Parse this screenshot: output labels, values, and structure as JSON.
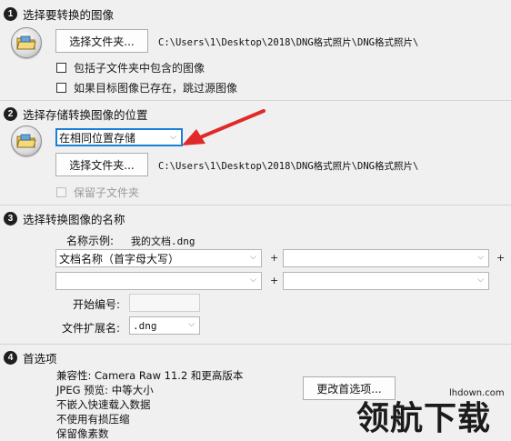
{
  "section1": {
    "number": "1",
    "title": "选择要转换的图像",
    "select_folder_label": "选择文件夹...",
    "path": "C:\\Users\\1\\Desktop\\2018\\DNG格式照片\\DNG格式照片\\",
    "include_subfolders_label": "包括子文件夹中包含的图像",
    "include_subfolders_checked": false,
    "skip_existing_label": "如果目标图像已存在，跳过源图像",
    "skip_existing_checked": false
  },
  "section2": {
    "number": "2",
    "title": "选择存储转换图像的位置",
    "location_select_value": "在相同位置存储",
    "select_folder_label": "选择文件夹...",
    "path": "C:\\Users\\1\\Desktop\\2018\\DNG格式照片\\DNG格式照片\\",
    "preserve_subfolders_label": "保留子文件夹",
    "preserve_subfolders_checked": false,
    "preserve_subfolders_disabled": true
  },
  "section3": {
    "number": "3",
    "title": "选择转换图像的名称",
    "example_label": "名称示例:",
    "example_value": "我的文档.dng",
    "name_field_1": "文档名称（首字母大写）",
    "name_field_2": "",
    "name_field_3": "",
    "name_field_4": "",
    "plus": "+",
    "start_number_label": "开始编号:",
    "start_number_value": "",
    "extension_label": "文件扩展名:",
    "extension_value": ".dng"
  },
  "section4": {
    "number": "4",
    "title": "首选项",
    "compatibility": "兼容性: Camera Raw 11.2 和更高版本",
    "jpeg_preview": "JPEG 预览: 中等大小",
    "fast_load": "不嵌入快速载入数据",
    "lossy": "不使用有损压缩",
    "pixel_count": "保留像素数",
    "change_prefs_label": "更改首选项..."
  },
  "watermark": {
    "text": "领航下载",
    "domain": "lhdown.com"
  },
  "colors": {
    "arrow": "#e02a2a",
    "focus": "#1a7fd6"
  }
}
